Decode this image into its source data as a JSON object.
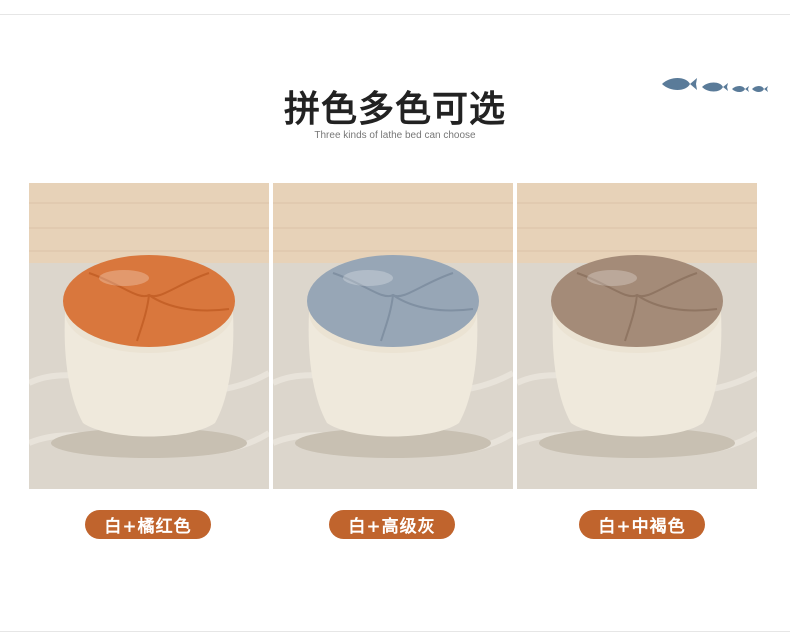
{
  "header": {
    "title": "拼色多色可选",
    "subtitle": "Three kinds of lathe bed can choose"
  },
  "products": [
    {
      "label": "白+橘红色",
      "seat_color": "#d9773d",
      "seat_shade": "#c56128"
    },
    {
      "label": "白+高级灰",
      "seat_color": "#97a6b6",
      "seat_shade": "#8090a2"
    },
    {
      "label": "白+中褐色",
      "seat_color": "#a48b78",
      "seat_shade": "#8f7562"
    }
  ],
  "colors": {
    "pill_background": "#c0642d",
    "fish": "#5a7b99",
    "body_cream": "#efe9dc"
  }
}
